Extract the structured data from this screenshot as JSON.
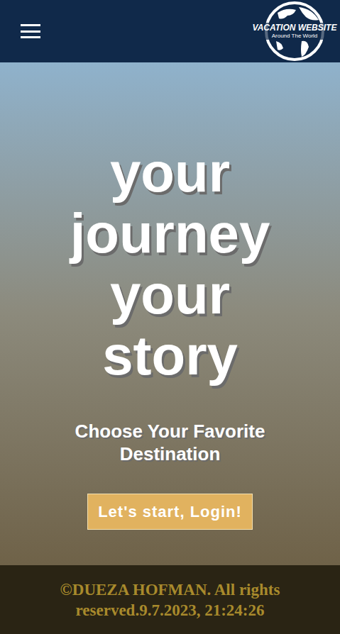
{
  "header": {
    "logo": {
      "title": "VACATION WEBSITE",
      "subtitle": "Around The World"
    }
  },
  "hero": {
    "headline": "your journey your story",
    "subtitle": "Choose Your Favorite Destination",
    "button": "Let's start, Login!"
  },
  "footer": {
    "text": "©DUEZA HOFMAN. All rights reserved.9.7.2023, 21:24:26"
  }
}
